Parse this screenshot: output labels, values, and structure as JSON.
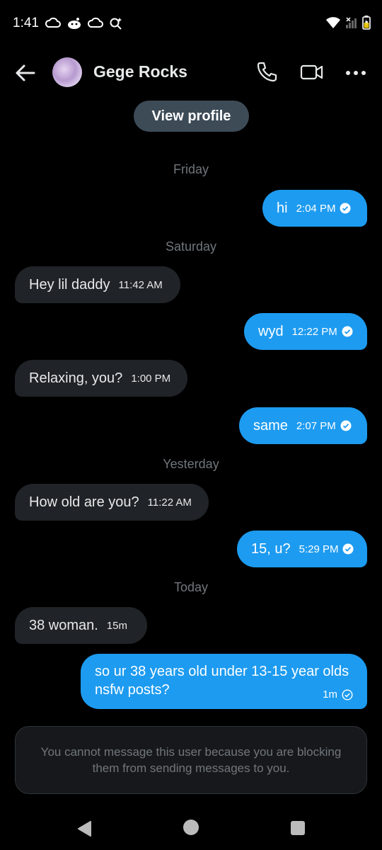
{
  "status_bar": {
    "time": "1:41",
    "left_icons": [
      "cloud-icon",
      "reddit-icon",
      "cloud-icon",
      "search-sparkle-icon"
    ],
    "right_icons": [
      "wifi-icon",
      "signal-icon",
      "battery-icon"
    ]
  },
  "header": {
    "contact_name": "Gege Rocks",
    "icons": [
      "back-arrow-icon",
      "phone-icon",
      "video-icon",
      "more-icon"
    ]
  },
  "view_profile_label": "View profile",
  "day_labels": {
    "friday": "Friday",
    "saturday": "Saturday",
    "yesterday": "Yesterday",
    "today": "Today"
  },
  "messages": [
    {
      "direction": "out",
      "text": "hi",
      "time": "2:04 PM",
      "status": "read"
    },
    {
      "direction": "in",
      "text": "Hey lil daddy",
      "time": "11:42 AM"
    },
    {
      "direction": "out",
      "text": "wyd",
      "time": "12:22 PM",
      "status": "read"
    },
    {
      "direction": "in",
      "text": "Relaxing, you?",
      "time": "1:00 PM"
    },
    {
      "direction": "out",
      "text": "same",
      "time": "2:07 PM",
      "status": "read"
    },
    {
      "direction": "in",
      "text": "How old are you?",
      "time": "11:22 AM"
    },
    {
      "direction": "out",
      "text": "15, u?",
      "time": "5:29 PM",
      "status": "read"
    },
    {
      "direction": "in",
      "text": "38 woman.",
      "time": "15m"
    },
    {
      "direction": "out",
      "text": "so ur 38 years old under 13-15 year olds nsfw posts?",
      "time": "1m",
      "status": "sent"
    }
  ],
  "blocked_notice": "You cannot message this user because you are blocking them from sending messages to you.",
  "colors": {
    "background": "#000000",
    "outgoing_bubble": "#1d9bf0",
    "incoming_bubble": "#202327",
    "muted_text": "#71767b"
  }
}
